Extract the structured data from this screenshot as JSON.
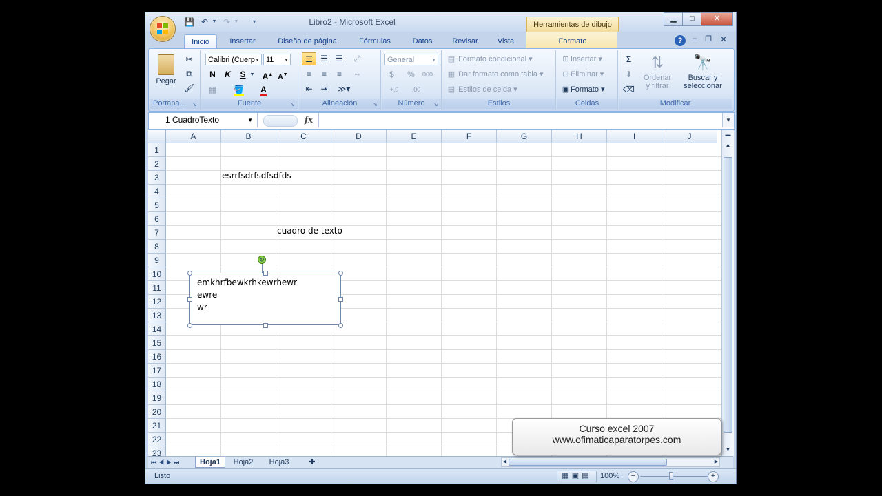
{
  "window": {
    "title": "Libro2 - Microsoft Excel",
    "context_tab_title": "Herramientas de dibujo",
    "controls": [
      "minimize",
      "maximize",
      "close"
    ]
  },
  "tabs": [
    {
      "label": "Inicio",
      "active": true
    },
    {
      "label": "Insertar"
    },
    {
      "label": "Diseño de página"
    },
    {
      "label": "Fórmulas"
    },
    {
      "label": "Datos"
    },
    {
      "label": "Revisar"
    },
    {
      "label": "Vista"
    },
    {
      "label": "Formato"
    }
  ],
  "ribbon": {
    "portapapeles": {
      "label": "Portapa...",
      "paste": "Pegar"
    },
    "fuente": {
      "label": "Fuente",
      "font_name": "Calibri (Cuerp",
      "font_size": "11",
      "bold": "N",
      "italic": "K",
      "underline": "S"
    },
    "alineacion": {
      "label": "Alineación"
    },
    "numero": {
      "label": "Número",
      "format": "General"
    },
    "estilos": {
      "label": "Estilos",
      "cond": "Formato condicional",
      "table": "Dar formato como tabla",
      "cell": "Estilos de celda"
    },
    "celdas": {
      "label": "Celdas",
      "insert": "Insertar",
      "delete": "Eliminar",
      "format": "Formato"
    },
    "modificar": {
      "label": "Modificar",
      "sort_1": "Ordenar",
      "sort_2": "y filtrar",
      "find_1": "Buscar y",
      "find_2": "seleccionar"
    }
  },
  "formula_bar": {
    "name_box": "1 CuadroTexto",
    "fx": "fx",
    "content": ""
  },
  "columns": [
    "A",
    "B",
    "C",
    "D",
    "E",
    "F",
    "G",
    "H",
    "I",
    "J"
  ],
  "rows": [
    "1",
    "2",
    "3",
    "4",
    "5",
    "6",
    "7",
    "8",
    "9",
    "10",
    "11",
    "12",
    "13",
    "14",
    "15",
    "16",
    "17",
    "18",
    "19",
    "20",
    "21",
    "22",
    "23"
  ],
  "cells": {
    "B2": "esrrfsdrfsdfsdfds",
    "C6": "cuadro de texto"
  },
  "textbox": {
    "lines": [
      "emkhrfbewkrhkewrhewr",
      "ewre",
      "wr"
    ]
  },
  "sheets": [
    {
      "label": "Hoja1",
      "active": true
    },
    {
      "label": "Hoja2"
    },
    {
      "label": "Hoja3"
    }
  ],
  "status": {
    "mode": "Listo",
    "zoom": "100%"
  },
  "watermark": {
    "line1": "Curso excel 2007",
    "line2": "www.ofimaticaparatorpes.com"
  }
}
